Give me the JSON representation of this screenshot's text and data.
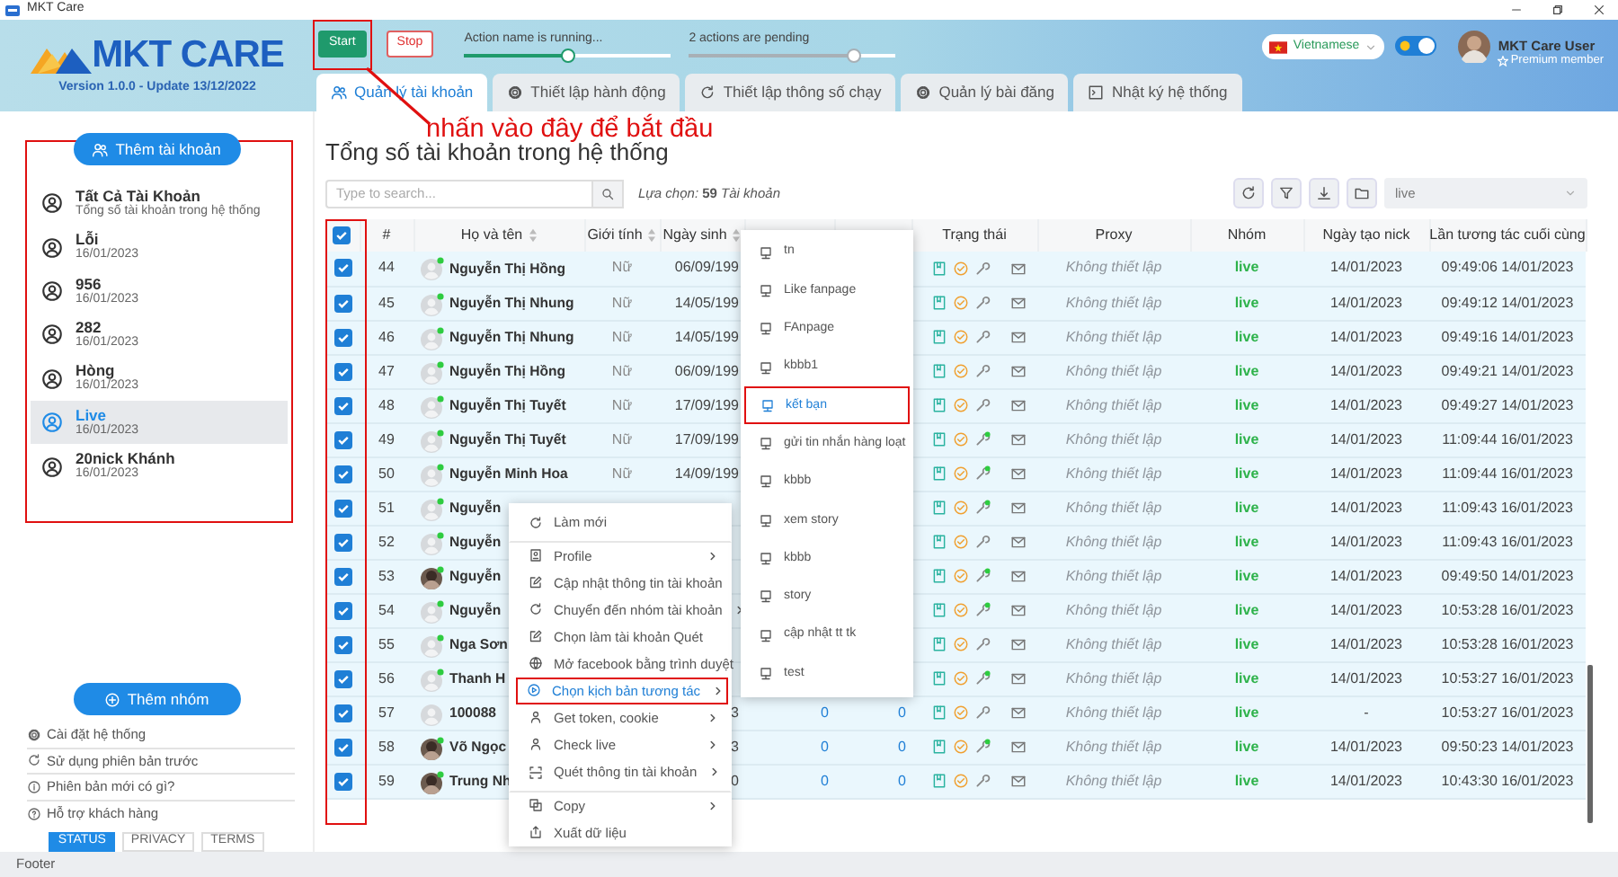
{
  "window": {
    "title": "MKT Care"
  },
  "header": {
    "logo": "MKT CARE",
    "version": "Version 1.0.0 - Update 13/12/2022",
    "buttons": [
      {
        "label": "Start",
        "kind": "start"
      },
      {
        "label": "Stop",
        "kind": "stop"
      }
    ],
    "progress": [
      {
        "label": "Action name is running...",
        "kind": "running",
        "level": 0.5
      },
      {
        "label": "2 actions are pending",
        "kind": "pending",
        "level": 0.8
      }
    ],
    "language": {
      "value": "Vietnamese"
    },
    "theme_toggle": {
      "on": true
    },
    "user": {
      "name": "MKT Care User",
      "badge": "Premium member"
    }
  },
  "tabs": [
    {
      "label": "Quản lý tài khoản",
      "selected": true
    },
    {
      "label": "Thiết lập hành động",
      "selected": false
    },
    {
      "label": "Thiết lập thông số chạy",
      "selected": false
    },
    {
      "label": "Quản lý bài đăng",
      "selected": false
    },
    {
      "label": "Nhật ký hệ thống",
      "selected": false
    }
  ],
  "annotation": {
    "text": "nhấn vào đây để bắt đầu"
  },
  "sidebar": {
    "add_account": "Thêm tài khoản",
    "groups": [
      {
        "title": "Tất Cả Tài Khoản",
        "subtitle": "Tổng số tài khoản trong hệ thống",
        "selected": false
      },
      {
        "title": "Lỗi",
        "subtitle": "16/01/2023",
        "selected": false
      },
      {
        "title": "956",
        "subtitle": "16/01/2023",
        "selected": false
      },
      {
        "title": "282",
        "subtitle": "16/01/2023",
        "selected": false
      },
      {
        "title": "Hòng",
        "subtitle": "16/01/2023",
        "selected": false
      },
      {
        "title": "Live",
        "subtitle": "16/01/2023",
        "selected": true
      },
      {
        "title": "20nick Khánh",
        "subtitle": "16/01/2023",
        "selected": false
      }
    ],
    "add_group": "Thêm nhóm",
    "links": [
      {
        "label": "Cài đặt hệ thống"
      },
      {
        "label": "Sử dụng phiên bản trước"
      },
      {
        "label": "Phiên bản mới có gì?"
      },
      {
        "label": "Hỗ trợ khách hàng"
      }
    ],
    "footer_links": [
      {
        "label": "STATUS",
        "selected": true
      },
      {
        "label": "PRIVACY",
        "selected": false
      },
      {
        "label": "TERMS",
        "selected": false
      }
    ]
  },
  "main": {
    "title": "Tổng số tài khoản trong hệ thống",
    "search": {
      "placeholder": "Type to search..."
    },
    "selection": "Lựa chọn: **59** Tài khoản",
    "filter": {
      "value": "live"
    },
    "table": {
      "all_checked": true,
      "columns": [
        {
          "label": "#",
          "sortable": false
        },
        {
          "label": "Họ và tên",
          "sortable": true
        },
        {
          "label": "Giới tính",
          "sortable": true
        },
        {
          "label": "Ngày sinh",
          "sortable": true
        },
        {
          "label": "Trạng thái",
          "sortable": false
        },
        {
          "label": "Proxy",
          "sortable": false
        },
        {
          "label": "Nhóm",
          "sortable": false
        },
        {
          "label": "Ngày tạo nick",
          "sortable": false
        },
        {
          "label": "Lần tương tác cuối cùng",
          "sortable": false
        }
      ],
      "rows": [
        {
          "checked": true,
          "no": "44",
          "photo": false,
          "online": true,
          "name": "Nguyễn Thị Hồng",
          "gender": "Nữ",
          "dob": "06/09/199",
          "tool_dot": false,
          "proxy": "Không thiết lập",
          "group": "live",
          "created": "14/01/2023",
          "last_interaction": "09:49:06 14/01/2023"
        },
        {
          "checked": true,
          "no": "45",
          "photo": false,
          "online": true,
          "name": "Nguyễn Thị Nhung",
          "gender": "Nữ",
          "dob": "14/05/199",
          "tool_dot": false,
          "proxy": "Không thiết lập",
          "group": "live",
          "created": "14/01/2023",
          "last_interaction": "09:49:12 14/01/2023"
        },
        {
          "checked": true,
          "no": "46",
          "photo": false,
          "online": true,
          "name": "Nguyễn Thị Nhung",
          "gender": "Nữ",
          "dob": "14/05/199",
          "tool_dot": false,
          "proxy": "Không thiết lập",
          "group": "live",
          "created": "14/01/2023",
          "last_interaction": "09:49:16 14/01/2023"
        },
        {
          "checked": true,
          "no": "47",
          "photo": false,
          "online": true,
          "name": "Nguyễn Thị Hồng",
          "gender": "Nữ",
          "dob": "06/09/199",
          "tool_dot": false,
          "proxy": "Không thiết lập",
          "group": "live",
          "created": "14/01/2023",
          "last_interaction": "09:49:21 14/01/2023"
        },
        {
          "checked": true,
          "no": "48",
          "photo": false,
          "online": true,
          "name": "Nguyễn Thị Tuyết",
          "gender": "Nữ",
          "dob": "17/09/199",
          "tool_dot": false,
          "proxy": "Không thiết lập",
          "group": "live",
          "created": "14/01/2023",
          "last_interaction": "09:49:27 14/01/2023"
        },
        {
          "checked": true,
          "no": "49",
          "photo": false,
          "online": true,
          "name": "Nguyễn Thị Tuyết",
          "gender": "Nữ",
          "dob": "17/09/199",
          "tool_dot": true,
          "proxy": "Không thiết lập",
          "group": "live",
          "created": "14/01/2023",
          "last_interaction": "11:09:44 16/01/2023"
        },
        {
          "checked": true,
          "no": "50",
          "photo": false,
          "online": true,
          "name": "Nguyễn Minh Hoa",
          "gender": "Nữ",
          "dob": "14/09/199",
          "tool_dot": true,
          "proxy": "Không thiết lập",
          "group": "live",
          "created": "14/01/2023",
          "last_interaction": "11:09:44 16/01/2023"
        },
        {
          "checked": true,
          "no": "51",
          "photo": false,
          "online": true,
          "name": "Nguyễn",
          "tool_dot": true,
          "proxy": "Không thiết lập",
          "group": "live",
          "created": "14/01/2023",
          "last_interaction": "11:09:43 16/01/2023"
        },
        {
          "checked": true,
          "no": "52",
          "photo": false,
          "online": true,
          "name": "Nguyễn",
          "tool_dot": false,
          "proxy": "Không thiết lập",
          "group": "live",
          "created": "14/01/2023",
          "last_interaction": "11:09:43 16/01/2023"
        },
        {
          "checked": true,
          "no": "53",
          "photo": true,
          "online": true,
          "name": "Nguyễn",
          "tool_dot": true,
          "proxy": "Không thiết lập",
          "group": "live",
          "created": "14/01/2023",
          "last_interaction": "09:49:50 14/01/2023"
        },
        {
          "checked": true,
          "no": "54",
          "photo": false,
          "online": true,
          "name": "Nguyễn",
          "tool_dot": true,
          "proxy": "Không thiết lập",
          "group": "live",
          "created": "14/01/2023",
          "last_interaction": "10:53:28 16/01/2023"
        },
        {
          "checked": true,
          "no": "55",
          "photo": false,
          "online": true,
          "name": "Nga Sơn",
          "tool_dot": false,
          "proxy": "Không thiết lập",
          "group": "live",
          "created": "14/01/2023",
          "last_interaction": "10:53:28 16/01/2023"
        },
        {
          "checked": true,
          "no": "56",
          "photo": false,
          "online": true,
          "name": "Thanh H",
          "tool_dot": true,
          "proxy": "Không thiết lập",
          "group": "live",
          "created": "14/01/2023",
          "last_interaction": "10:53:27 16/01/2023"
        },
        {
          "checked": true,
          "no": "57",
          "photo": false,
          "online": false,
          "name": "100088",
          "dob": "3",
          "column_6": "0",
          "column_7": "0",
          "tool_dot": false,
          "proxy": "Không thiết lập",
          "group": "live",
          "created": "-",
          "last_interaction": "10:53:27 16/01/2023"
        },
        {
          "checked": true,
          "no": "58",
          "photo": true,
          "online": true,
          "name": "Võ Ngọc",
          "dob": "3",
          "column_6": "0",
          "column_7": "0",
          "tool_dot": true,
          "proxy": "Không thiết lập",
          "group": "live",
          "created": "14/01/2023",
          "last_interaction": "09:50:23 14/01/2023"
        },
        {
          "checked": true,
          "no": "59",
          "photo": true,
          "online": true,
          "name": "Trung Nh",
          "dob": "0",
          "column_6": "0",
          "column_7": "0",
          "tool_dot": false,
          "proxy": "Không thiết lập",
          "group": "live",
          "created": "14/01/2023",
          "last_interaction": "10:43:30 16/01/2023"
        }
      ]
    }
  },
  "context_menu": {
    "items": [
      {
        "label": "Làm mới",
        "submenu": false,
        "divider_after": true,
        "selected": false
      },
      {
        "label": "Profile",
        "submenu": true,
        "divider_after": false,
        "selected": false
      },
      {
        "label": "Cập nhật thông tin tài khoản",
        "submenu": false,
        "divider_after": false,
        "selected": false
      },
      {
        "label": "Chuyển đến nhóm tài khoản",
        "submenu": true,
        "divider_after": false,
        "selected": false
      },
      {
        "label": "Chọn làm tài khoản Quét",
        "submenu": false,
        "divider_after": false,
        "selected": false
      },
      {
        "label": "Mở facebook bằng trình duyệt",
        "submenu": false,
        "divider_after": false,
        "selected": false
      },
      {
        "label": "Chọn kịch bản tương tác",
        "submenu": true,
        "divider_after": false,
        "selected": true
      },
      {
        "label": "Get token, cookie",
        "submenu": true,
        "divider_after": false,
        "selected": false
      },
      {
        "label": "Check live",
        "submenu": true,
        "divider_after": false,
        "selected": false
      },
      {
        "label": "Quét thông tin tài khoản",
        "submenu": true,
        "divider_after": true,
        "selected": false
      },
      {
        "label": "Copy",
        "submenu": true,
        "divider_after": false,
        "selected": false
      },
      {
        "label": "Xuất dữ liệu",
        "submenu": false,
        "divider_after": false,
        "selected": false
      }
    ]
  },
  "submenu": {
    "items": [
      {
        "label": "tn",
        "selected": false
      },
      {
        "label": "Like fanpage",
        "selected": false
      },
      {
        "label": "FAnpage",
        "selected": false
      },
      {
        "label": "kbbb1",
        "selected": false
      },
      {
        "label": "kết bạn",
        "selected": true
      },
      {
        "label": "gửi tin nhắn hàng loạt",
        "selected": false
      },
      {
        "label": "kbbb",
        "selected": false
      },
      {
        "label": "xem story",
        "selected": false
      },
      {
        "label": "kbbb",
        "selected": false
      },
      {
        "label": "story",
        "selected": false
      },
      {
        "label": "cập nhật tt tk",
        "selected": false
      },
      {
        "label": "test",
        "selected": false
      }
    ]
  },
  "status_bar": {
    "text": "Footer"
  }
}
